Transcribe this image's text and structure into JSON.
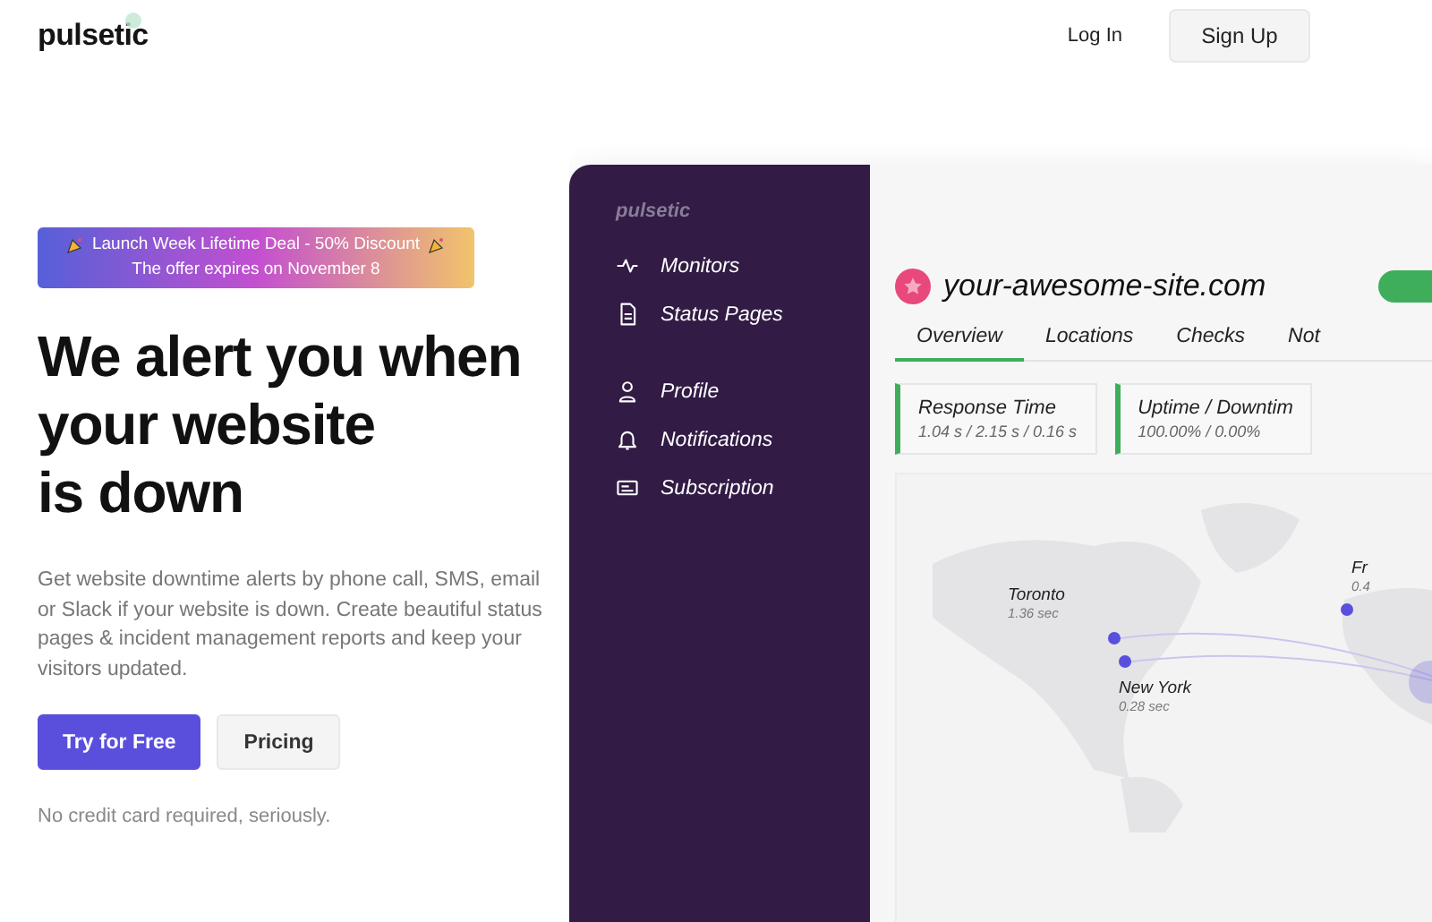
{
  "header": {
    "logo": "pulsetic",
    "login": "Log In",
    "signup": "Sign Up"
  },
  "hero": {
    "banner": {
      "title": "Launch Week Lifetime Deal - 50% Discount",
      "subtitle": "The offer expires on November 8"
    },
    "headline": [
      "We alert you when",
      "your website",
      "is down"
    ],
    "description": "Get website downtime alerts by phone call, SMS, email or Slack if your website is down. Create beautiful status pages & incident management reports and keep your visitors updated.",
    "buttons": [
      {
        "label": "Try for Free",
        "kind": "primary"
      },
      {
        "label": "Pricing",
        "kind": "secondary"
      }
    ],
    "note": "No credit card required, seriously."
  },
  "mockup": {
    "sidebar": {
      "logo": "pulsetic",
      "groups": [
        [
          {
            "label": "Monitors",
            "kind": "pulse"
          },
          {
            "label": "Status Pages",
            "kind": "document"
          }
        ],
        [
          {
            "label": "Profile",
            "kind": "person"
          },
          {
            "label": "Notifications",
            "kind": "bell"
          },
          {
            "label": "Subscription",
            "kind": "card"
          }
        ]
      ]
    },
    "site": {
      "name": "your-awesome-site.com"
    },
    "tabs": [
      {
        "label": "Overview",
        "selected": true
      },
      {
        "label": "Locations",
        "selected": false
      },
      {
        "label": "Checks",
        "selected": false
      },
      {
        "label": "Not",
        "selected": false
      }
    ],
    "cards": [
      {
        "title": "Response Time",
        "value": "1.04 s / 2.15 s / 0.16 s"
      },
      {
        "title": "Uptime / Downtim",
        "value": "100.00% / 0.00%"
      }
    ],
    "map": {
      "markers": [
        {
          "city": "Toronto",
          "time": "1.36 sec"
        },
        {
          "city": "New York",
          "time": "0.28 sec"
        },
        {
          "city": "Fr",
          "time": "0.4"
        }
      ]
    }
  }
}
